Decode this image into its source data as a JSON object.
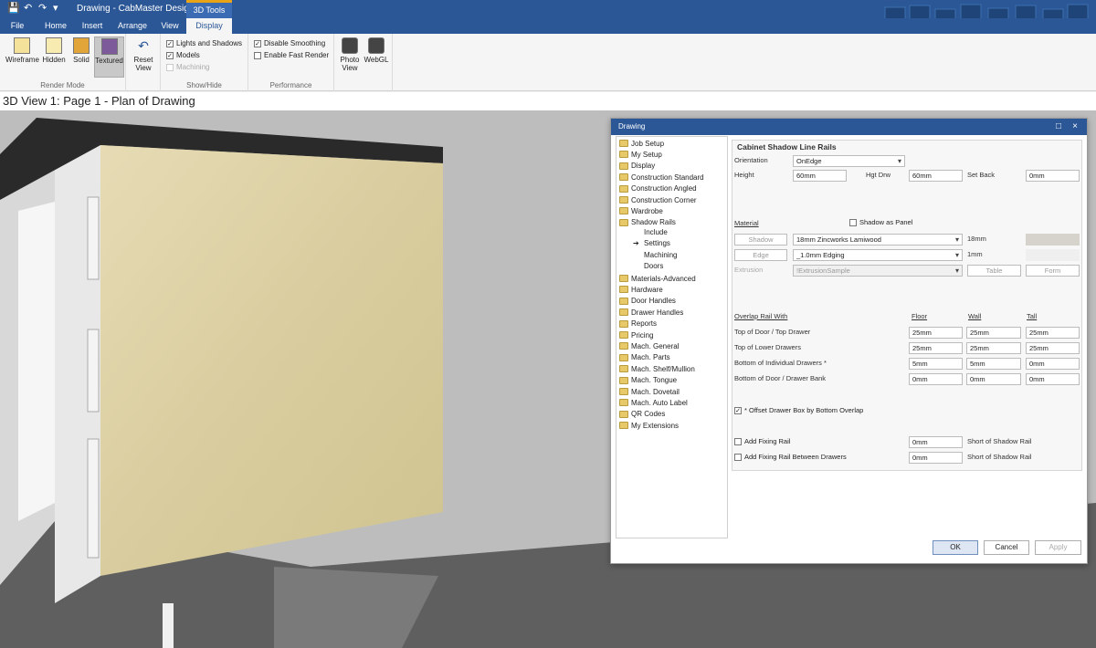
{
  "titlebar": {
    "title": "Drawing - CabMaster Designer",
    "context_tab": "3D Tools",
    "save_icon": "💾",
    "undo_icon": "↶",
    "redo_icon": "↷",
    "qa_menu": "▾"
  },
  "tabs": [
    "File",
    "Home",
    "Insert",
    "Arrange",
    "View",
    "Display"
  ],
  "ribbon": {
    "render_mode": {
      "label": "Render Mode",
      "buttons": [
        "Wireframe",
        "Hidden",
        "Solid",
        "Textured"
      ],
      "active": "Textured"
    },
    "reset_view": {
      "line1": "Reset",
      "line2": "View"
    },
    "show_hide": {
      "label": "Show/Hide",
      "lights_and_shadows": "Lights and Shadows",
      "models": "Models",
      "machining": "Machining"
    },
    "performance": {
      "label": "Performance",
      "disable_smoothing": "Disable Smoothing",
      "enable_fast_render": "Enable Fast Render"
    },
    "photo_view": {
      "line1": "Photo",
      "line2": "View"
    },
    "webgl": "WebGL"
  },
  "view_caption": "3D View 1: Page 1 - Plan of Drawing",
  "dialog": {
    "title": "Drawing",
    "maximize_icon": "□",
    "close_icon": "×",
    "tree": {
      "items_top": [
        "Job Setup",
        "My Setup",
        "Display",
        "Construction Standard",
        "Construction Angled",
        "Construction Corner",
        "Wardrobe",
        "Shadow Rails"
      ],
      "children": [
        "Include",
        "Settings",
        "Machining",
        "Doors"
      ],
      "selected_child": "Settings",
      "items_bottom": [
        "Materials-Advanced",
        "Hardware",
        "Door Handles",
        "Drawer Handles",
        "Reports",
        "Pricing",
        "Mach. General",
        "Mach. Parts",
        "Mach. Shelf/Mullion",
        "Mach. Tongue",
        "Mach. Dovetail",
        "Mach. Auto Label",
        "QR Codes",
        "My Extensions"
      ]
    },
    "panel": {
      "heading": "Cabinet Shadow Line Rails",
      "orientation_label": "Orientation",
      "orientation_value": "OnEdge",
      "height_label": "Height",
      "height_value": "60mm",
      "hgt_drw_label": "Hgt Drw",
      "hgt_drw_value": "60mm",
      "set_back_label": "Set Back",
      "set_back_value": "0mm",
      "material_label": "Material",
      "shadow_as_panel": "Shadow as Panel",
      "shadow_btn": "Shadow",
      "shadow_material": "18mm Zincworks Lamiwood",
      "shadow_thickness": "18mm",
      "edge_btn": "Edge",
      "edge_material": "_1.0mm Edging",
      "edge_thickness": "1mm",
      "extrusion_label": "Extrusion",
      "extrusion_value": "!ExtrusionSample",
      "table_btn": "Table",
      "form_btn": "Form",
      "overlap_label": "Overlap Rail With",
      "cols": [
        "Floor",
        "Wall",
        "Tall"
      ],
      "rows": [
        {
          "label": "Top of Door / Top Drawer",
          "values": [
            "25mm",
            "25mm",
            "25mm"
          ]
        },
        {
          "label": "Top of Lower Drawers",
          "values": [
            "25mm",
            "25mm",
            "25mm"
          ]
        },
        {
          "label": "Bottom of Individual Drawers *",
          "values": [
            "5mm",
            "5mm",
            "0mm"
          ]
        },
        {
          "label": "Bottom of Door / Drawer Bank",
          "values": [
            "0mm",
            "0mm",
            "0mm"
          ]
        }
      ],
      "offset_drawer": "* Offset Drawer Box by Bottom Overlap",
      "add_fixing_rail": "Add Fixing Rail",
      "add_fixing_rail_value": "0mm",
      "add_fixing_between": "Add Fixing Rail Between Drawers",
      "add_fixing_between_value": "0mm",
      "short_of_1": "Short of Shadow Rail",
      "short_of_2": "Short of Shadow Rail"
    },
    "buttons": {
      "ok": "OK",
      "cancel": "Cancel",
      "apply": "Apply"
    }
  }
}
